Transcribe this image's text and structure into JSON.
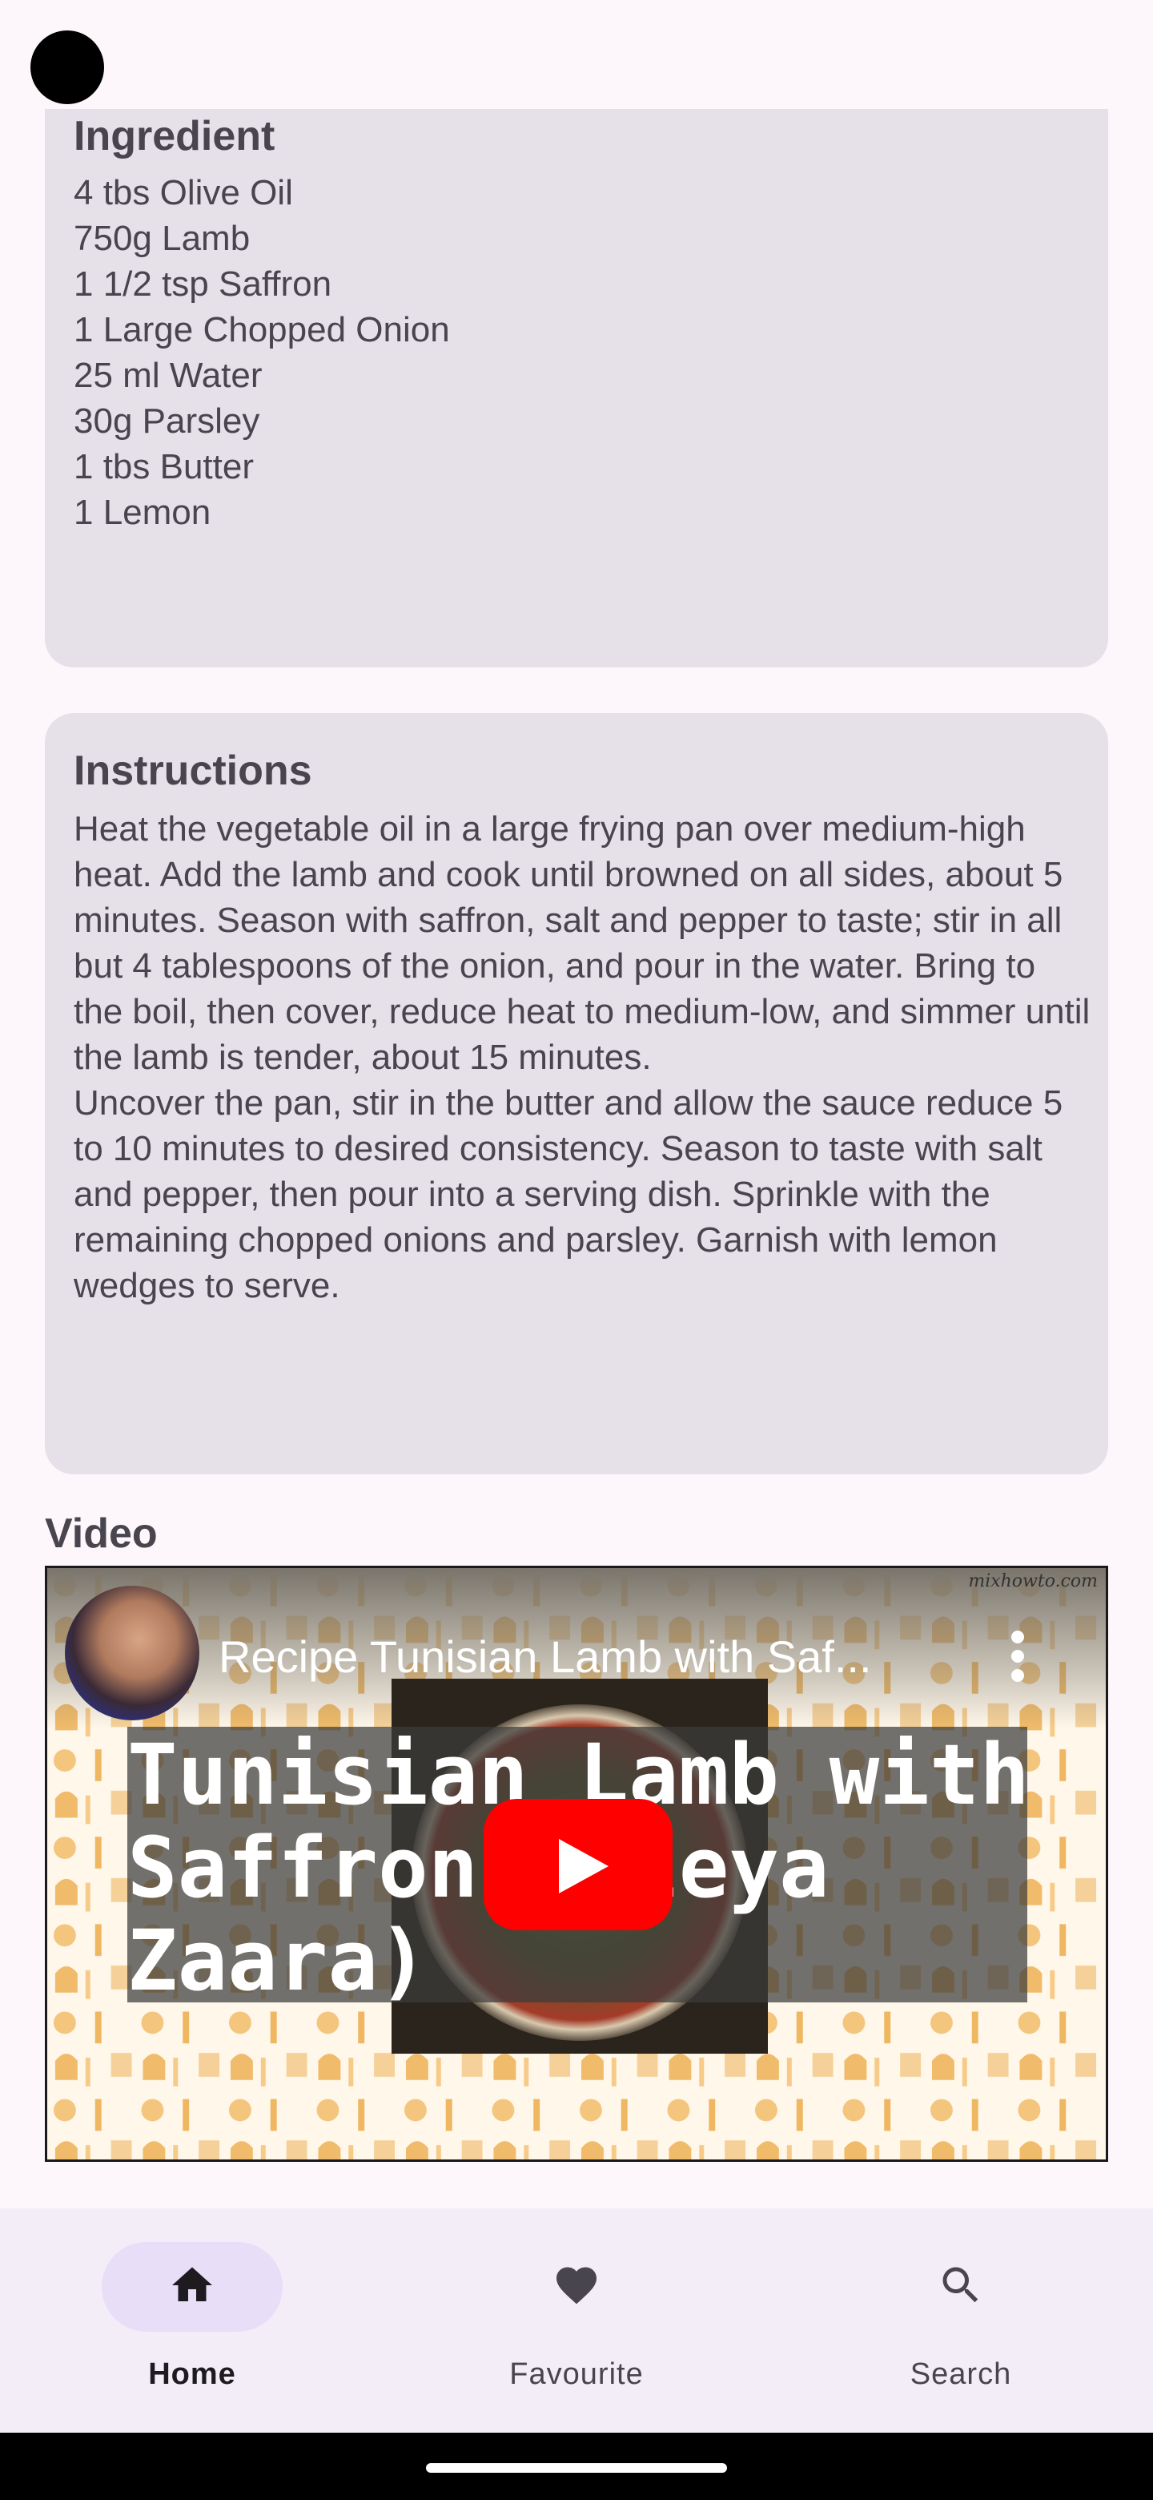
{
  "ingredients": {
    "title": "Ingredient",
    "body": "4 tbs Olive Oil\n750g Lamb\n1 1/2 tsp  Saffron\n1 Large Chopped Onion\n25 ml Water\n30g Parsley\n1 tbs Butter\n1 Lemon"
  },
  "instructions": {
    "title": "Instructions",
    "body": "Heat the vegetable oil in a large frying pan over medium-high heat. Add the lamb and cook until browned on all sides, about 5 minutes. Season with saffron, salt and pepper to taste; stir in all but 4 tablespoons of the onion, and pour in the water. Bring to the boil, then cover, reduce heat to medium-low, and simmer until the lamb is tender, about 15 minutes.\nUncover the pan, stir in the butter and allow the sauce reduce 5 to 10 minutes to desired consistency. Season to taste with salt and pepper, then pour into a serving dish. Sprinkle with the remaining chopped onions and parsley. Garnish with lemon wedges to serve."
  },
  "video": {
    "section_title": "Video",
    "caption": "Recipe Tunisian Lamb with Saf...",
    "overlay_text": "Tunisian Lamb with\nSaffron (Sleya\nZaara)",
    "watermark": "mixhowto.com"
  },
  "bottom_nav": {
    "items": [
      {
        "label": "Home",
        "icon": "home-icon",
        "active": true
      },
      {
        "label": "Favourite",
        "icon": "heart-icon",
        "active": false
      },
      {
        "label": "Search",
        "icon": "search-icon",
        "active": false
      }
    ]
  },
  "colors": {
    "background": "#fdf7fc",
    "card": "#e6e0e9",
    "text": "#49454f",
    "nav_background": "#f3edf7",
    "nav_active_pill": "#e8def8",
    "play_button": "#ff0000"
  }
}
